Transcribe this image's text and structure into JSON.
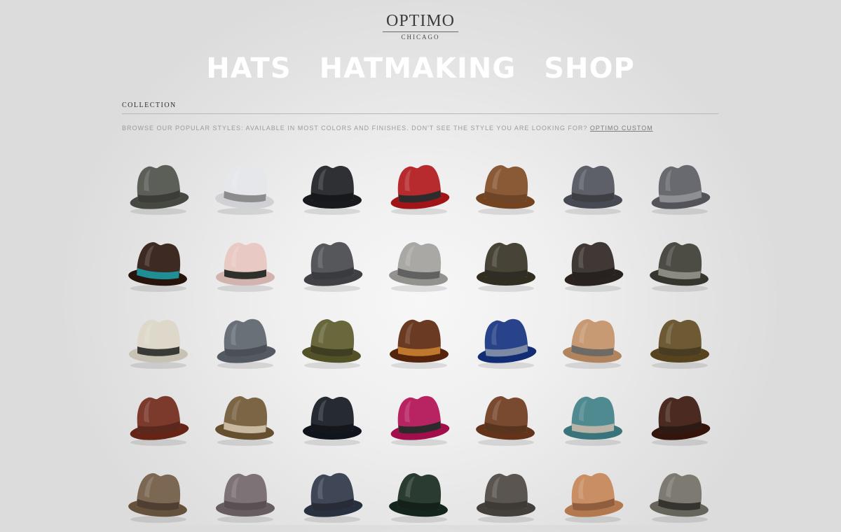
{
  "brand": {
    "name": "OPTIMO",
    "city": "CHICAGO"
  },
  "nav": {
    "items": [
      "HATS",
      "HATMAKING",
      "SHOP"
    ]
  },
  "section": {
    "heading": "COLLECTION",
    "intro": "BROWSE OUR POPULAR STYLES: AVAILABLE IN MOST COLORS AND FINISHES. DON'T SEE THE STYLE YOU ARE LOOKING FOR?",
    "link": "OPTIMO CUSTOM"
  },
  "colors": {
    "nav_text": "#ffffff",
    "heading": "#2f2f2f",
    "intro_text": "#9b9b9b"
  },
  "hats": [
    {
      "icon": "fedora-hat-icon",
      "crown": "#5c5e58",
      "band": "#3c3d39"
    },
    {
      "icon": "fedora-hat-icon",
      "crown": "#e6e7ea",
      "band": "#8c8c8c"
    },
    {
      "icon": "fedora-hat-icon",
      "crown": "#2e3034",
      "band": "#17181b"
    },
    {
      "icon": "fedora-hat-icon",
      "crown": "#b72a2e",
      "band": "#2c2c2c"
    },
    {
      "icon": "fedora-hat-icon",
      "crown": "#8a5a36",
      "band": "#6e4526"
    },
    {
      "icon": "fedora-hat-icon",
      "crown": "#5d6068",
      "band": "#3d3f45"
    },
    {
      "icon": "fedora-hat-icon",
      "crown": "#686a70",
      "band": "#8d8f93"
    },
    {
      "icon": "fedora-hat-icon",
      "crown": "#3d2a22",
      "band": "#1f8f95"
    },
    {
      "icon": "fedora-hat-icon",
      "crown": "#e9c9c4",
      "band": "#2f2f2c"
    },
    {
      "icon": "fedora-hat-icon",
      "crown": "#55575b",
      "band": "#3a3b3e"
    },
    {
      "icon": "fedora-hat-icon",
      "crown": "#a9a8a5",
      "band": "#616161"
    },
    {
      "icon": "fedora-hat-icon",
      "crown": "#474437",
      "band": "#2f2d25"
    },
    {
      "icon": "fedora-hat-icon",
      "crown": "#3f3834",
      "band": "#27221f"
    },
    {
      "icon": "fedora-hat-icon",
      "crown": "#4c4c45",
      "band": "#8d8a82"
    },
    {
      "icon": "fedora-hat-icon",
      "crown": "#ddd8c9",
      "band": "#3a3a36"
    },
    {
      "icon": "fedora-hat-icon",
      "crown": "#697078",
      "band": "#4b5057"
    },
    {
      "icon": "fedora-hat-icon",
      "crown": "#69683c",
      "band": "#3f3e23"
    },
    {
      "icon": "fedora-hat-icon",
      "crown": "#6a3a22",
      "band": "#c0782e"
    },
    {
      "icon": "fedora-hat-icon",
      "crown": "#28438a",
      "band": "#7c8aa5"
    },
    {
      "icon": "fedora-hat-icon",
      "crown": "#c89a74",
      "band": "#6e6a66"
    },
    {
      "icon": "fedora-hat-icon",
      "crown": "#6d5a34",
      "band": "#4a3c22"
    },
    {
      "icon": "fedora-hat-icon",
      "crown": "#7b3a2c",
      "band": "#5a281d"
    },
    {
      "icon": "fedora-hat-icon",
      "crown": "#7b6544",
      "band": "#c9b9a0"
    },
    {
      "icon": "fedora-hat-icon",
      "crown": "#262a33",
      "band": "#14161b"
    },
    {
      "icon": "fedora-hat-icon",
      "crown": "#b82361",
      "band": "#2b2b2b"
    },
    {
      "icon": "fedora-hat-icon",
      "crown": "#7a4a30",
      "band": "#59341f"
    },
    {
      "icon": "fedora-hat-icon",
      "crown": "#4e8a90",
      "band": "#b9b3a8"
    },
    {
      "icon": "fedora-hat-icon",
      "crown": "#4a2a21",
      "band": "#2e1a15"
    },
    {
      "icon": "fedora-hat-icon",
      "crown": "#7c6753",
      "band": "#4e3f32"
    },
    {
      "icon": "fedora-hat-icon",
      "crown": "#7d7275",
      "band": "#5a4f52"
    },
    {
      "icon": "fedora-hat-icon",
      "crown": "#3f4656",
      "band": "#272c37"
    },
    {
      "icon": "fedora-hat-icon",
      "crown": "#2a3b32",
      "band": "#16201b"
    },
    {
      "icon": "fedora-hat-icon",
      "crown": "#5a5550",
      "band": "#3e3a36"
    },
    {
      "icon": "fedora-hat-icon",
      "crown": "#c98e63",
      "band": "#8e5e3e"
    },
    {
      "icon": "fedora-hat-icon",
      "crown": "#7d7a72",
      "band": "#35342f"
    }
  ]
}
